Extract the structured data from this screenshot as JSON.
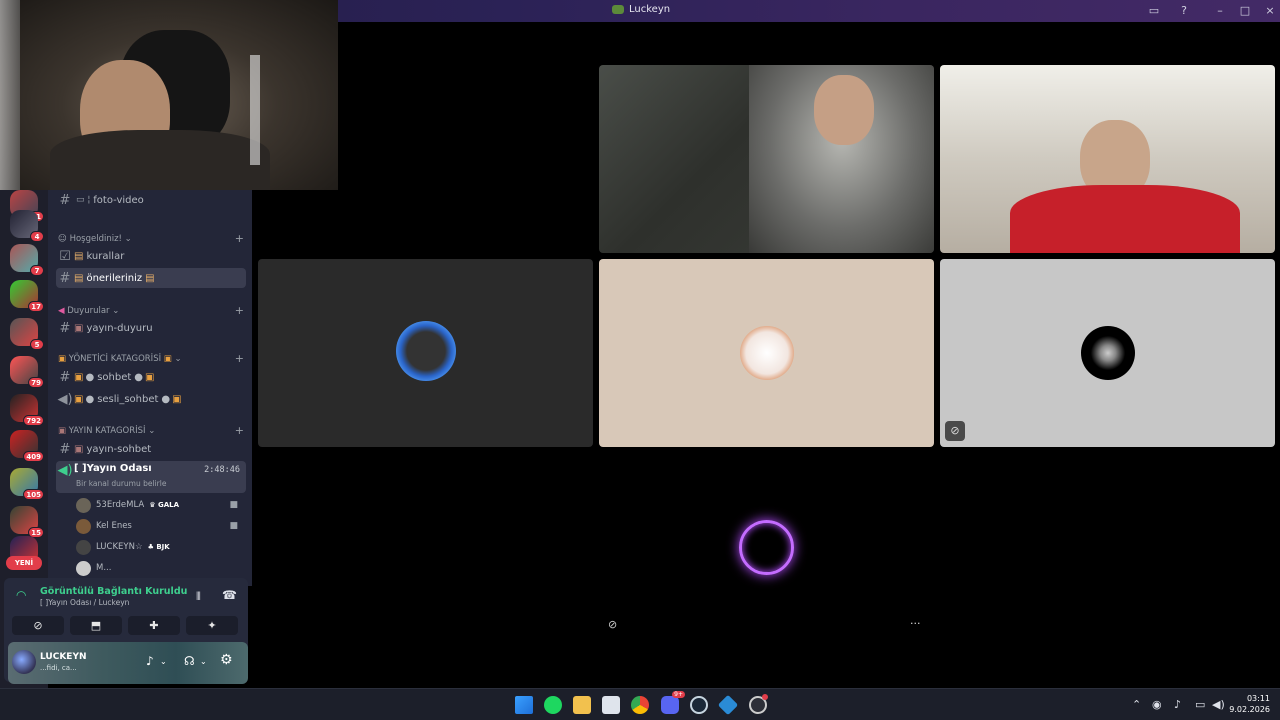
{
  "window": {
    "title": "Luckeyn"
  },
  "server_rail": {
    "badges": [
      "11",
      "4",
      "7",
      "17",
      "5",
      "79",
      "792",
      "409",
      "105",
      "15"
    ],
    "new_label": "YENİ"
  },
  "channels": {
    "top_channel": "foto-video",
    "categories": [
      {
        "name": "Hoşgeldiniz!",
        "channels": [
          "kurallar",
          "önerileriniz"
        ]
      },
      {
        "name": "Duyurular",
        "channels": [
          "yayın-duyuru"
        ]
      },
      {
        "name": "YÖNETİCİ KATAGORİSİ",
        "channels": [
          "sohbet",
          "sesli_sohbet"
        ]
      },
      {
        "name": "YAYIN KATAGORİSİ",
        "channels": [
          "yayın-sohbet"
        ]
      }
    ],
    "voice_channel": {
      "name": "[ ]Yayın Odası",
      "timer": "2:48:46",
      "status": "Bir kanal durumu belirle"
    },
    "voice_users": [
      {
        "name": "53ErdeMLA",
        "tag": "GALA"
      },
      {
        "name": "Kel Enes",
        "tag": ""
      },
      {
        "name": "LUCKEYN☆",
        "tag": "BJK"
      },
      {
        "name": "M...",
        "tag": ""
      }
    ]
  },
  "voice_panel": {
    "status": "Görüntülü Bağlantı Kuruldu",
    "location": "[ ]Yayın Odası / Luckeyn"
  },
  "user_panel": {
    "name": "LUCKEYN",
    "sub": "...fidi, ca..."
  },
  "taskbar": {
    "time": "03:11",
    "date": "9.02.2026",
    "discord_badge": "9+"
  },
  "colors": {
    "connected_green": "#3ecf8e",
    "badge_red": "#e23d4a",
    "speaking_ring": "#b44dff"
  }
}
